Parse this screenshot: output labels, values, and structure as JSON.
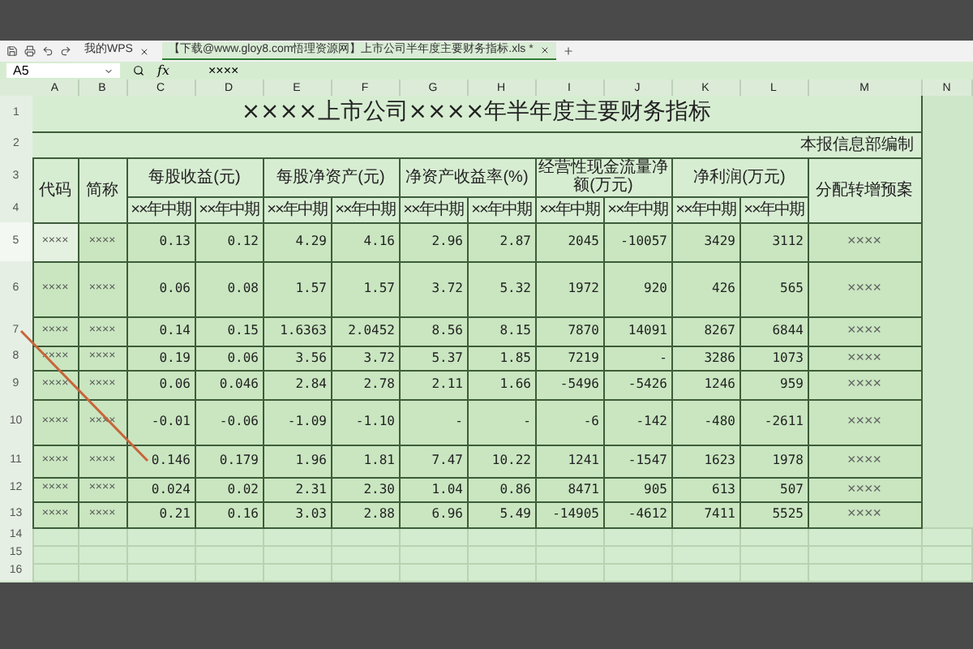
{
  "tabs": [
    {
      "label": "我的WPS",
      "selected": false
    },
    {
      "label": "【下载@www.gloy8.com悟理资源网】上市公司半年度主要财务指标.xls *",
      "selected": true
    }
  ],
  "name_box": "A5",
  "formula_label": "fx",
  "formula": "××××",
  "columns": [
    "A",
    "B",
    "C",
    "D",
    "E",
    "F",
    "G",
    "H",
    "I",
    "J",
    "K",
    "L",
    "M",
    "N"
  ],
  "title": "××××上市公司××××年半年度主要财务指标",
  "subtitle": "本报信息部编制",
  "header_fixed": [
    "代码",
    "简称"
  ],
  "header_groups": [
    "每股收益(元)",
    "每股净资产(元)",
    "净资产收益率(%)",
    "经营性现金流量净额(万元)",
    "净利润(万元)"
  ],
  "header_last": "分配转增预案",
  "subheaders": [
    "××年中期",
    "××年中期",
    "××年中期",
    "××年中期",
    "××年中期",
    "××年中期",
    "××年中期",
    "××年中期",
    "××年中期",
    "××年中期"
  ],
  "top_row_numbers": [
    "1",
    "2",
    "3",
    "4"
  ],
  "rows": [
    {
      "number": "5",
      "selected": true,
      "code": "××××",
      "name": "××××",
      "values": [
        "0.13",
        "0.12",
        "4.29",
        "4.16",
        "2.96",
        "2.87",
        "2045",
        "-10057",
        "3429",
        "3112"
      ],
      "plan": "××××"
    },
    {
      "number": "6",
      "selected": false,
      "code": "××××",
      "name": "××××",
      "values": [
        "0.06",
        "0.08",
        "1.57",
        "1.57",
        "3.72",
        "5.32",
        "1972",
        "920",
        "426",
        "565"
      ],
      "plan": "××××"
    },
    {
      "number": "7",
      "selected": false,
      "code": "××××",
      "name": "××××",
      "values": [
        "0.14",
        "0.15",
        "1.6363",
        "2.0452",
        "8.56",
        "8.15",
        "7870",
        "14091",
        "8267",
        "6844"
      ],
      "plan": "××××"
    },
    {
      "number": "8",
      "selected": false,
      "code": "××××",
      "name": "××××",
      "values": [
        "0.19",
        "0.06",
        "3.56",
        "3.72",
        "5.37",
        "1.85",
        "7219",
        "-",
        "3286",
        "1073"
      ],
      "plan": "××××"
    },
    {
      "number": "9",
      "selected": false,
      "code": "××××",
      "name": "××××",
      "values": [
        "0.06",
        "0.046",
        "2.84",
        "2.78",
        "2.11",
        "1.66",
        "-5496",
        "-5426",
        "1246",
        "959"
      ],
      "plan": "××××"
    },
    {
      "number": "10",
      "selected": false,
      "code": "××××",
      "name": "××××",
      "values": [
        "-0.01",
        "-0.06",
        "-1.09",
        "-1.10",
        "-",
        "-",
        "-6",
        "-142",
        "-480",
        "-2611"
      ],
      "plan": "××××"
    },
    {
      "number": "11",
      "selected": false,
      "code": "××××",
      "name": "××××",
      "values": [
        "0.146",
        "0.179",
        "1.96",
        "1.81",
        "7.47",
        "10.22",
        "1241",
        "-1547",
        "1623",
        "1978"
      ],
      "plan": "××××"
    },
    {
      "number": "12",
      "selected": false,
      "code": "××××",
      "name": "××××",
      "values": [
        "0.024",
        "0.02",
        "2.31",
        "2.30",
        "1.04",
        "0.86",
        "8471",
        "905",
        "613",
        "507"
      ],
      "plan": "××××"
    },
    {
      "number": "13",
      "selected": false,
      "code": "××××",
      "name": "××××",
      "values": [
        "0.21",
        "0.16",
        "3.03",
        "2.88",
        "6.96",
        "5.49",
        "-14905",
        "-4612",
        "7411",
        "5525"
      ],
      "plan": "××××"
    }
  ],
  "empty_rows": [
    "14",
    "15",
    "16"
  ]
}
